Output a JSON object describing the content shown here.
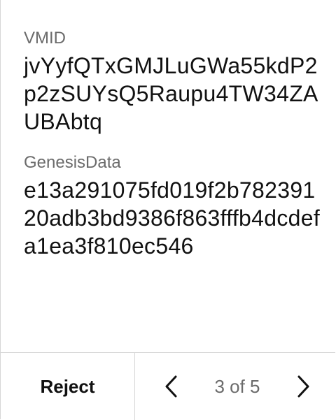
{
  "fields": [
    {
      "label": "VMID",
      "value": "jvYyfQTxGMJLuGWa55kdP2p2zSUYsQ5Raupu4TW34ZAUBAbtq"
    },
    {
      "label": "GenesisData",
      "value": "e13a291075fd019f2b78239120adb3bd9386f863fffb4dcdefa1ea3f810ec546"
    }
  ],
  "footer": {
    "reject_label": "Reject",
    "page_indicator": "3 of 5",
    "prev_icon": "chevron-left-icon",
    "next_icon": "chevron-right-icon"
  }
}
